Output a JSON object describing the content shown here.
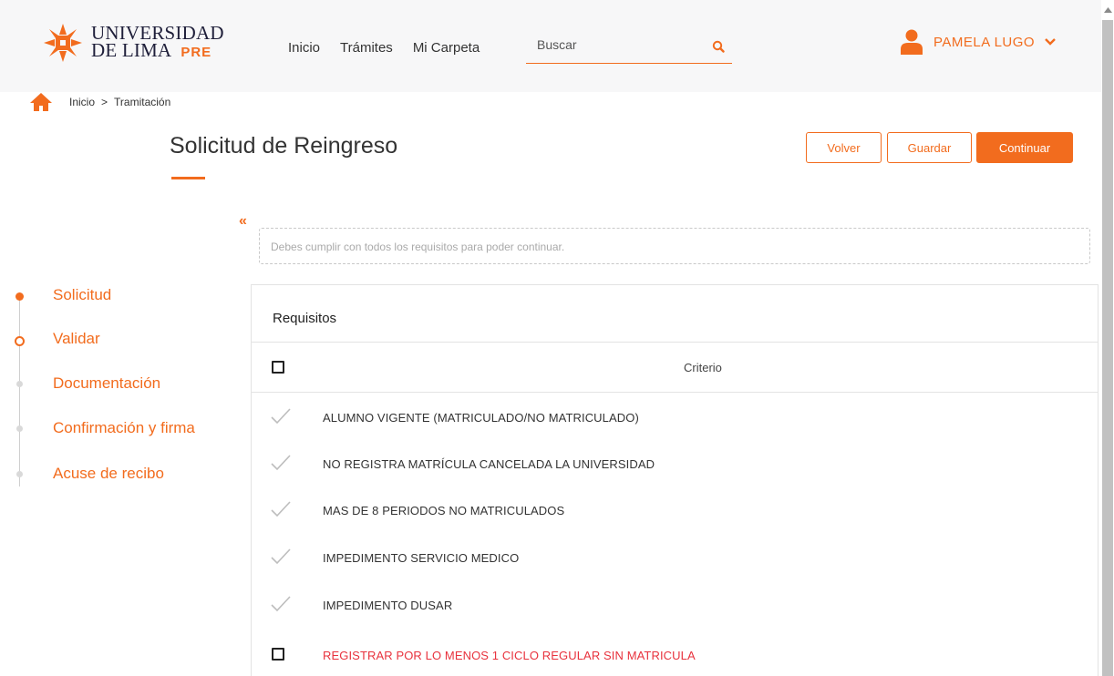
{
  "header": {
    "logo": {
      "line1": "UNIVERSIDAD",
      "line2": "DE LIMA",
      "badge": "PRE",
      "icon": "university-logo-icon"
    },
    "nav": [
      {
        "label": "Inicio"
      },
      {
        "label": "Trámites"
      },
      {
        "label": "Mi Carpeta"
      }
    ],
    "search": {
      "placeholder": "Buscar",
      "icon": "search-icon"
    },
    "user": {
      "name": "PAMELA LUGO",
      "icon": "user-icon",
      "dropdown_icon": "chevron-down-icon"
    }
  },
  "breadcrumb": {
    "home_icon": "home-icon",
    "items": [
      "Inicio",
      "Tramitación"
    ],
    "separator": ">"
  },
  "page": {
    "title": "Solicitud de Reingreso",
    "buttons": {
      "volver": "Volver",
      "guardar": "Guardar",
      "continuar": "Continuar"
    },
    "collapse": "«",
    "notice": "Debes cumplir con todos los requisitos para poder continuar."
  },
  "stepper": {
    "steps": [
      {
        "label": "Solicitud",
        "state": "done"
      },
      {
        "label": "Validar",
        "state": "current"
      },
      {
        "label": "Documentación",
        "state": "pending"
      },
      {
        "label": "Confirmación y firma",
        "state": "pending"
      },
      {
        "label": "Acuse de recibo",
        "state": "pending"
      }
    ]
  },
  "requisitos": {
    "title": "Requisitos",
    "column": "Criterio",
    "rows": [
      {
        "text": "ALUMNO VIGENTE (MATRICULADO/NO MATRICULADO)",
        "status": "ok"
      },
      {
        "text": "NO REGISTRA MATRÍCULA CANCELADA LA UNIVERSIDAD",
        "status": "ok"
      },
      {
        "text": "MAS DE 8 PERIODOS NO MATRICULADOS",
        "status": "ok"
      },
      {
        "text": "IMPEDIMENTO SERVICIO MEDICO",
        "status": "ok"
      },
      {
        "text": "IMPEDIMENTO DUSAR",
        "status": "ok"
      },
      {
        "text": "REGISTRAR POR LO MENOS 1 CICLO REGULAR SIN MATRICULA",
        "status": "pending"
      }
    ]
  },
  "colors": {
    "accent": "#f26c1e",
    "warning": "#e8323d",
    "header_bg": "#f7f7f8"
  }
}
